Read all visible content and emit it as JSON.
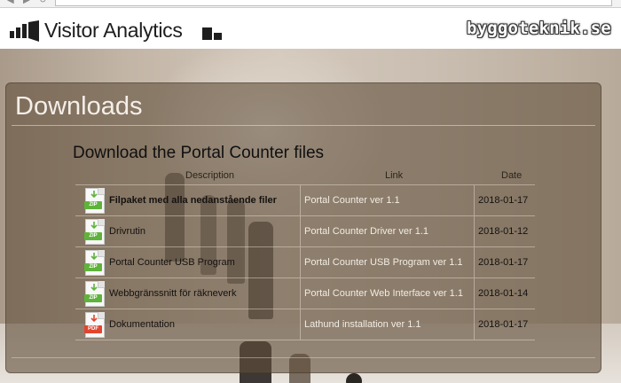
{
  "header": {
    "brand": "Visitor Analytics",
    "watermark": "byggoteknik.se"
  },
  "panel": {
    "title": "Downloads",
    "section_title": "Download the Portal Counter files"
  },
  "table": {
    "columns": [
      "Description",
      "Link",
      "Date"
    ],
    "rows": [
      {
        "type": "ZIP",
        "description": "Filpaket med alla nedanstående filer",
        "bold": true,
        "link": "Portal Counter ver 1.1",
        "date": "2018-01-17"
      },
      {
        "type": "ZIP",
        "description": "Drivrutin",
        "bold": false,
        "link": "Portal Counter Driver ver 1.1",
        "date": "2018-01-12"
      },
      {
        "type": "ZIP",
        "description": "Portal Counter USB Program",
        "bold": false,
        "link": "Portal Counter USB Program ver 1.1",
        "date": "2018-01-17"
      },
      {
        "type": "ZIP",
        "description": "Webbgränssnitt för räkneverk",
        "bold": false,
        "link": "Portal Counter Web Interface ver 1.1",
        "date": "2018-01-14"
      },
      {
        "type": "PDF",
        "description": "Dokumentation",
        "bold": false,
        "link": "Lathund installation ver 1.1",
        "date": "2018-01-17"
      }
    ]
  },
  "colors": {
    "zip_tag": "#5fb33a",
    "pdf_tag": "#e2452f",
    "link_text": "#f2ece3"
  },
  "icons": {
    "zip": "zip-file-icon",
    "pdf": "pdf-file-icon",
    "brand_left": "bar-chart-logo-icon",
    "brand_right": "bar-logo-icon"
  }
}
